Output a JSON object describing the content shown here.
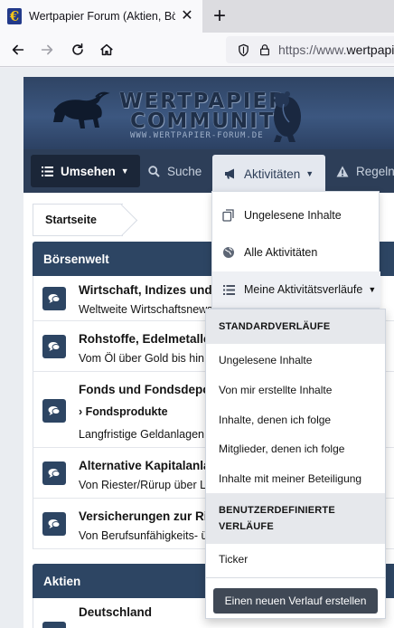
{
  "browser": {
    "tab_title": "Wertpapier Forum (Aktien, Börse",
    "tab_favicon": "€",
    "url_host": "https://www.",
    "url_domain": "wertpapier"
  },
  "banner": {
    "title_line1": "WERTPAPIER",
    "title_line2": "COMMUNITY",
    "url": "WWW.WERTPAPIER-FORUM.DE"
  },
  "nav": {
    "umsehen": "Umsehen",
    "suche": "Suche",
    "aktivitaeten": "Aktivitäten",
    "regeln": "Regeln"
  },
  "breadcrumb": "Startseite",
  "sections": [
    {
      "title": "Börsenwelt",
      "nodes": [
        {
          "title": "Wirtschaft, Indizes und W",
          "desc": "Weltweite Wirtschaftsnews"
        },
        {
          "title": "Rohstoffe, Edelmetalle",
          "desc": "Vom Öl über Gold bis hin z"
        },
        {
          "title": "Fonds und Fondsdepot",
          "sub": "Fondsprodukte",
          "desc": "Langfristige Geldanlagen"
        },
        {
          "title": "Alternative Kapitalanla",
          "desc": "Von Riester/Rürup über Leb"
        },
        {
          "title": "Versicherungen zur Ris",
          "desc": "Von Berufsunfähigkeits- üb"
        }
      ]
    },
    {
      "title": "Aktien",
      "nodes": [
        {
          "title": "Deutschland"
        }
      ]
    }
  ],
  "activity_menu": {
    "items": [
      "Ungelesene Inhalte",
      "Alle Aktivitäten",
      "Meine Aktivitätsverläufe"
    ]
  },
  "streams_menu": {
    "standard_heading": "STANDARDVERLÄUFE",
    "standard_items": [
      "Ungelesene Inhalte",
      "Von mir erstellte Inhalte",
      "Inhalte, denen ich folge",
      "Mitglieder, denen ich folge",
      "Inhalte mit meiner Beteiligung"
    ],
    "custom_heading_line1": "BENUTZERDEFINIERTE",
    "custom_heading_line2": "VERLÄUFE",
    "custom_items": [
      "Ticker"
    ],
    "create_button": "Einen neuen Verlauf erstellen"
  }
}
